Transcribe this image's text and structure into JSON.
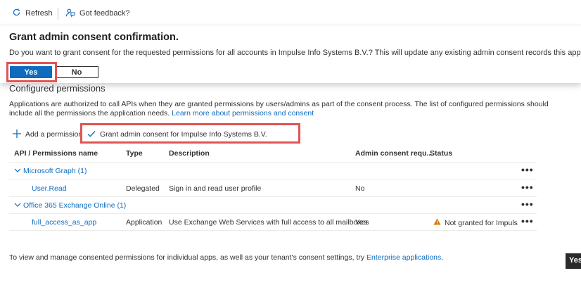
{
  "toolbar": {
    "refresh_label": "Refresh",
    "feedback_label": "Got feedback?"
  },
  "consent": {
    "title": "Grant admin consent confirmation.",
    "message": "Do you want to grant consent for the requested permissions for all accounts in Impulse Info Systems B.V.? This will update any existing admin consent records this application a",
    "yes_label": "Yes",
    "no_label": "No"
  },
  "permissions": {
    "heading": "Configured permissions",
    "description": "Applications are authorized to call APIs when they are granted permissions by users/admins as part of the consent process. The list of configured permissions should include all the permissions the application needs.",
    "learn_more": "Learn more about permissions and consent",
    "add_permission": "Add a permission",
    "grant_consent": "Grant admin consent for Impulse Info Systems B.V."
  },
  "table": {
    "headers": {
      "api": "API / Permissions name",
      "type": "Type",
      "description": "Description",
      "admin": "Admin consent requ...",
      "status": "Status"
    },
    "groups": [
      {
        "name": "Microsoft Graph (1)",
        "rows": [
          {
            "name": "User.Read",
            "type": "Delegated",
            "description": "Sign in and read user profile",
            "admin": "No",
            "status": ""
          }
        ]
      },
      {
        "name": "Office 365 Exchange Online (1)",
        "rows": [
          {
            "name": "full_access_as_app",
            "type": "Application",
            "description": "Use Exchange Web Services with full access to all mailboxes",
            "admin": "Yes",
            "status": "Not granted for Impulse..."
          }
        ]
      }
    ]
  },
  "footer": {
    "text": "To view and manage consented permissions for individual apps, as well as your tenant's consent settings, try",
    "link": "Enterprise applications",
    "end": "."
  },
  "corner_label": "Yes",
  "colors": {
    "accent": "#0f6cbd",
    "highlight": "#e05454",
    "warning": "#d47500"
  }
}
